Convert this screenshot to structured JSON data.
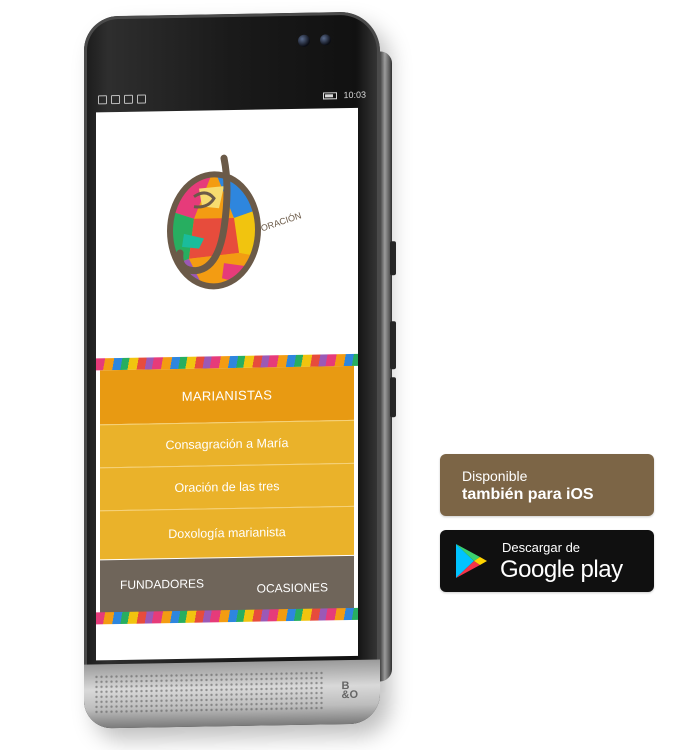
{
  "status_bar": {
    "time": "10:03"
  },
  "app": {
    "logo_text": "ORACIÓN",
    "menu_header": "MARIANISTAS",
    "menu_items": [
      {
        "label": "Consagración a María"
      },
      {
        "label": "Oración de las tres"
      },
      {
        "label": "Doxología marianista"
      }
    ],
    "bottom_nav": {
      "left": "FUNDADORES",
      "right": "OCASIONES"
    }
  },
  "phone": {
    "brand_mark_top": "B",
    "brand_mark_bottom": "&O"
  },
  "badges": {
    "ios": {
      "line1": "Disponible",
      "line2": "también para iOS"
    },
    "google_play": {
      "line1": "Descargar de",
      "line2": "Google play"
    }
  },
  "colors": {
    "menu_header": "#e89a12",
    "menu_item": "#eab22a",
    "bottom_nav": "#6f655a",
    "ios_badge": "#7c6546",
    "google_badge": "#101010"
  },
  "icons": {
    "logo": "mosaic-j-logo",
    "play_store": "google-play-triangle-icon"
  }
}
